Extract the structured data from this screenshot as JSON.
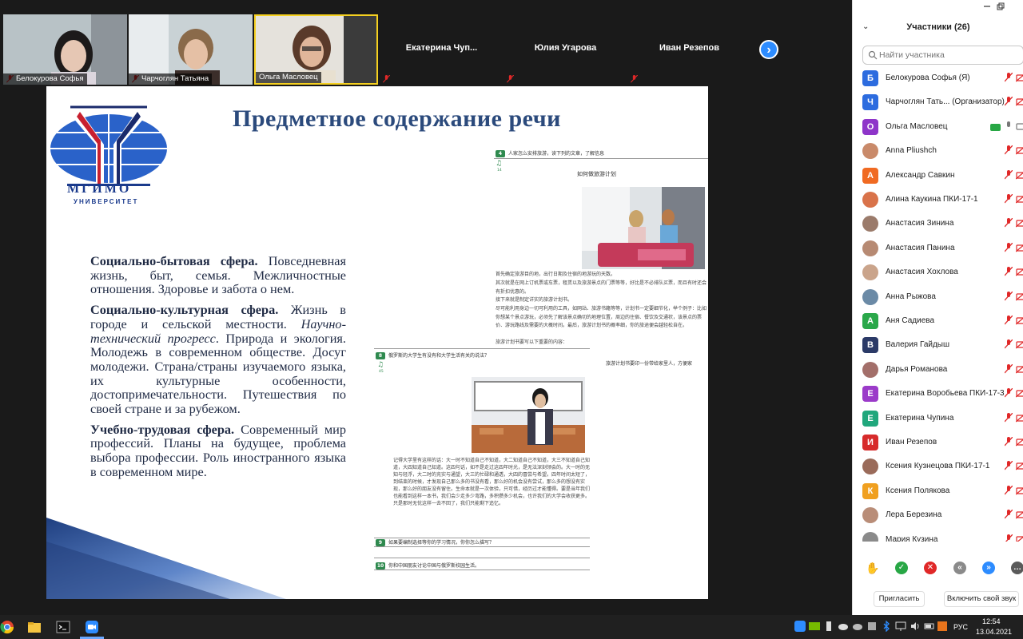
{
  "video_strip": {
    "tiles": [
      {
        "name": "Белокурова Софья",
        "kind": "video"
      },
      {
        "name": "Чарчоглян Татьяна",
        "kind": "video"
      },
      {
        "name": "Ольга Масловец",
        "kind": "video"
      },
      {
        "name": "Екатерина  Чуп...",
        "kind": "name"
      },
      {
        "name": "Юлия Угарова",
        "kind": "name"
      },
      {
        "name": "Иван Резепов",
        "kind": "name"
      }
    ],
    "next_icon": "chevron-right-icon"
  },
  "slide": {
    "title": "Предметное содержание речи",
    "logo_text": "МГИМО",
    "logo_sub": "УНИВЕРСИТЕТ",
    "p1_bold": "Социально-бытовая сфера.",
    "p1_text": " Повседневная жизнь, быт, семья. Межличностные отношения. Здоровье и забота о нем.",
    "p2_bold": "Социально-культурная сфера.",
    "p2_text1": " Жизнь в городе и сельской местности. ",
    "p2_italic": "Научно-технический прогресс",
    "p2_text2": ". Природа и экология. Молодежь в современном обществе. Досуг молодежи. Страна/страны изучаемого языка, их культурные особенности, достопримечательности. Путешествия по своей стране и за рубежом.",
    "p3_bold": "Учебно-трудовая сфера.",
    "p3_text": " Современный мир профессий. Планы на будущее, проблема выбора профессии. Роль иностранного языка в современном мире.",
    "book": {
      "n4": "4",
      "q4": "人家怎么安排旅游，读下列的文章，了解信息",
      "sub4": "14",
      "heading": "如何做旅游计划",
      "para1": "首先确定旅游目的地，出行日期及住宿的地游玩的天数。",
      "para2": "其次就是在网上订机票或车票，租赁以及旅游景点的门票等等，好比是不必排队买票，而且有时还会有折扣优惠的。",
      "para3": "接下来就是制定详实的旅游计划书。",
      "para4": "尽可能利用身边一切可利用的工具，如网站、旅游书籍等等，计划书一定要细节化，举个例子：比如你想某个景点游玩，必须先了解该景点确切的地理位置，周边的住宿、餐饮及交通状，该景点的票价、游玩路线及需要的大概时间。最后，旅游计划书的概率细，你的旅途便会越轻松自在。",
      "para5": "旅游计划书要写以下重要的内容：",
      "right_note": "旅游计划书要印一份带给家里人，方便家",
      "n8": "8",
      "q8": "俄罗斯的大学生有没有和大学生活有关的说法？",
      "sub8": "45",
      "story": "记得大学里有这样的话：大一时不知道自己不知道，大二知道自己不知道，大三不知道自己知道，大四知道自己知道。这四句话，如不是走过这四年时光，是无法深刻领会的。大一时的无知与轻浮，大二时的充实与通望，大三的忙碌和通透，大四的冒尝与希望。四年时间太短了，到结束的时候，才发现自己那么多的书没有看，那么好的机会没有尝试，那么多的想没有实现，那么好的朋友没有留住。生命本就是一次体验，只可惜，经历过才能懂得。要是当年我们也能看到这样一本书，我们会少走多少弯路，多积攒多少机会，也许我们的大学会收获更多。只是那时无忧这样一去不回了，我们只能剩下追忆。",
      "n9": "9",
      "q9": "如果要编制选择等你的学习情况，你你怎么描写？",
      "n10": "10",
      "q10": "你和中国朋友讨论中国与俄罗斯校园生活。"
    }
  },
  "panel": {
    "title": "Участники (26)",
    "search_placeholder": "Найти участника",
    "participants": [
      {
        "initial": "Б",
        "name": "Белокурова Софья (Я)",
        "color": "#2d6cdf",
        "photo": false
      },
      {
        "initial": "Ч",
        "name": "Чарчоглян Тать... (Организатор)",
        "color": "#2d6cdf",
        "photo": false
      },
      {
        "initial": "О",
        "name": "Ольга Масловец",
        "color": "#8e35c9",
        "photo": false,
        "video": true
      },
      {
        "initial": "",
        "name": "Anna Pliushch",
        "color": "#c98a6a",
        "photo": true
      },
      {
        "initial": "А",
        "name": "Александр Савкин",
        "color": "#f06a22",
        "photo": false
      },
      {
        "initial": "",
        "name": "Алина Каукина ПКИ-17-1",
        "color": "#d9734a",
        "photo": true
      },
      {
        "initial": "",
        "name": "Анастасия Зинина",
        "color": "#9b7b6b",
        "photo": true
      },
      {
        "initial": "",
        "name": "Анастасия Панина",
        "color": "#b78a73",
        "photo": true
      },
      {
        "initial": "",
        "name": "Анастасия Хохлова",
        "color": "#caa48b",
        "photo": true
      },
      {
        "initial": "",
        "name": "Анна Рыжова",
        "color": "#6b8aa6",
        "photo": true
      },
      {
        "initial": "А",
        "name": "Аня Садиева",
        "color": "#2aa84a",
        "photo": false
      },
      {
        "initial": "В",
        "name": "Валерия Гайдыш",
        "color": "#2b3a67",
        "photo": false
      },
      {
        "initial": "",
        "name": "Дарья Романова",
        "color": "#a36f6a",
        "photo": true
      },
      {
        "initial": "Е",
        "name": "Екатерина Воробьева ПКИ-17-3",
        "color": "#9b3bc9",
        "photo": false
      },
      {
        "initial": "Е",
        "name": "Екатерина Чупина",
        "color": "#20a77c",
        "photo": false
      },
      {
        "initial": "И",
        "name": "Иван Резепов",
        "color": "#d72b2b",
        "photo": false
      },
      {
        "initial": "",
        "name": "Ксения Кузнецова ПКИ-17-1",
        "color": "#9a6b5a",
        "photo": true
      },
      {
        "initial": "К",
        "name": "Ксения Полякова",
        "color": "#f0a020",
        "photo": false
      },
      {
        "initial": "",
        "name": "Лера Березина",
        "color": "#b98d78",
        "photo": true
      },
      {
        "initial": "",
        "name": "Мария Кузина",
        "color": "#8a8a8a",
        "photo": true
      }
    ],
    "invite_label": "Пригласить",
    "unmute_label": "Включить свой звук"
  },
  "taskbar": {
    "lang": "РУС",
    "time": "12:54",
    "date": "13.04.2021"
  }
}
